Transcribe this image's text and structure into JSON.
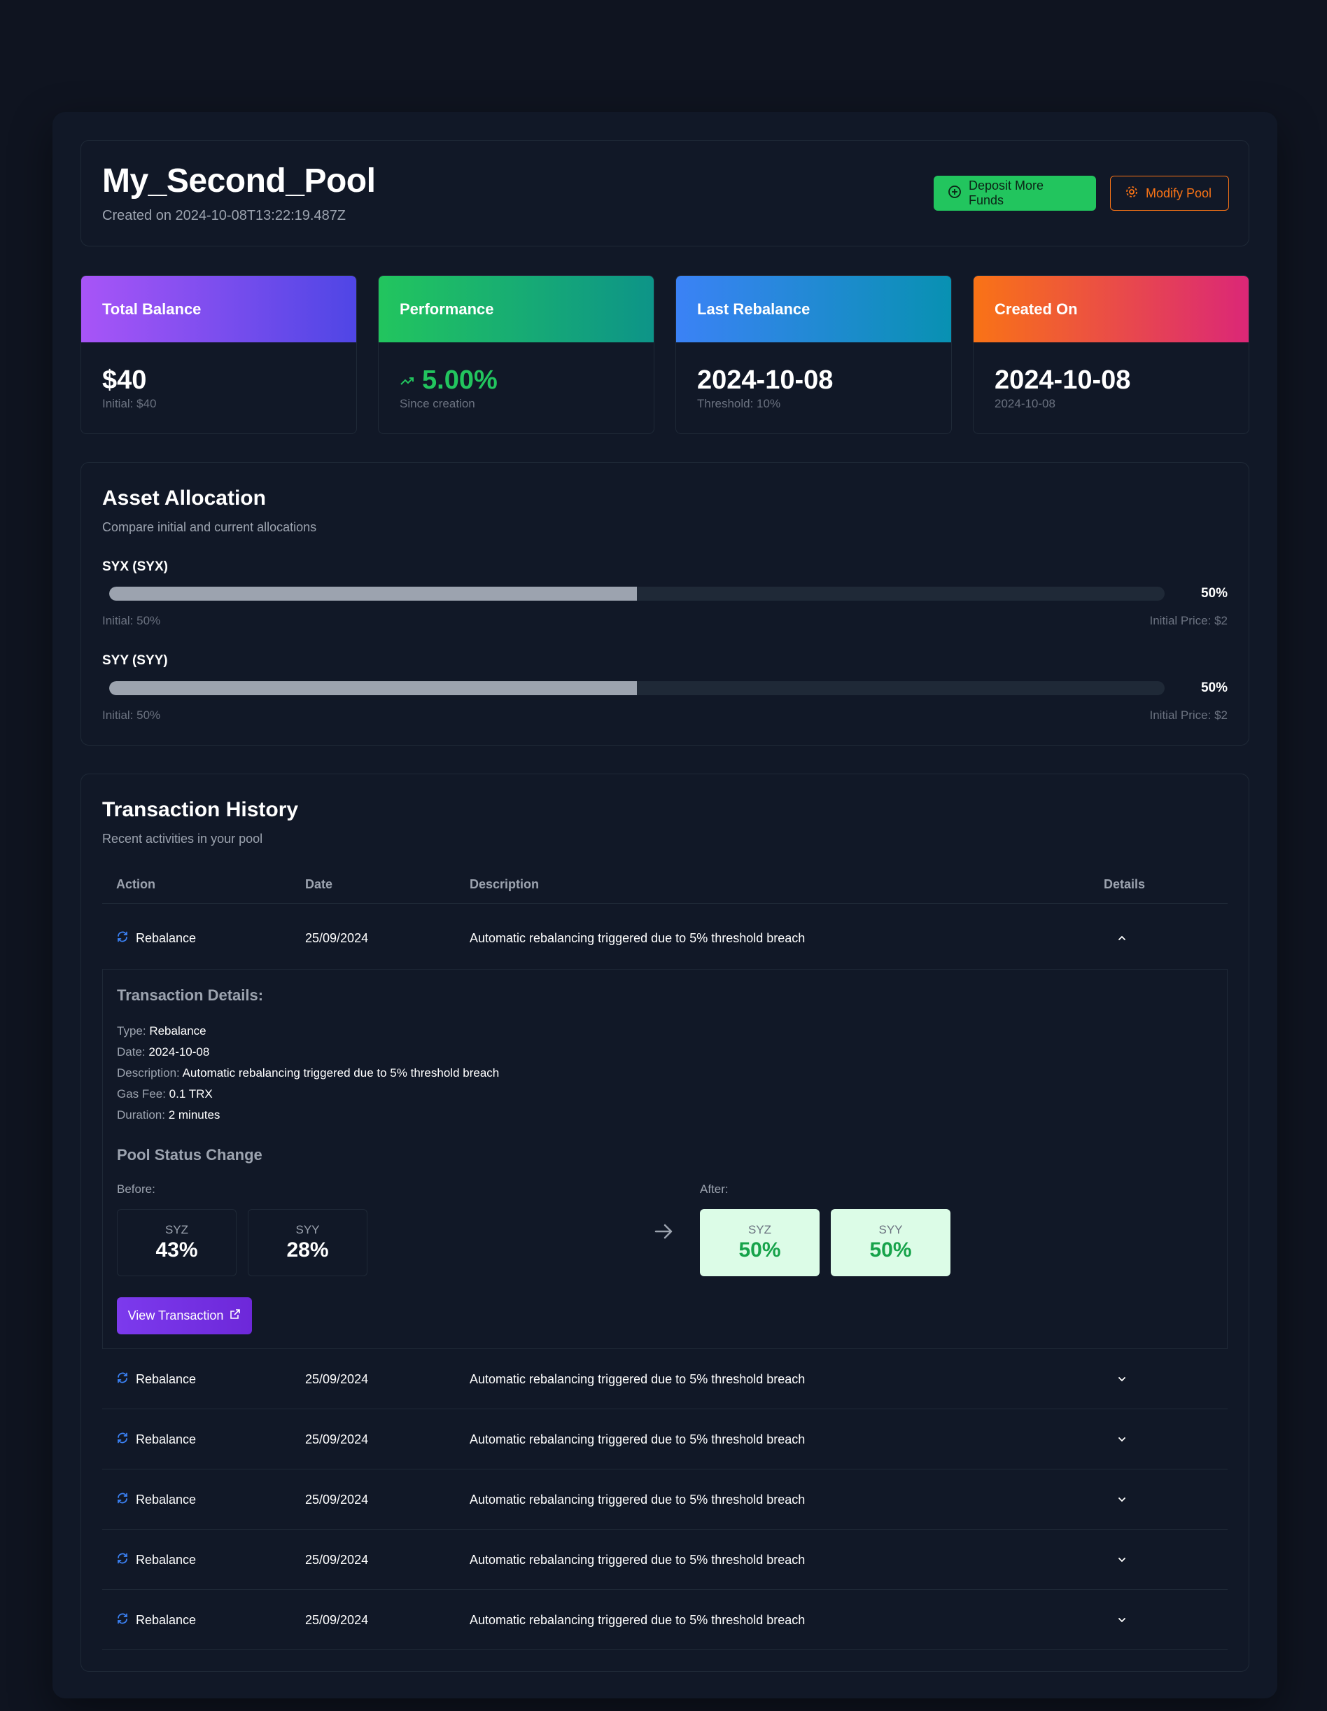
{
  "pool": {
    "name": "My_Second_Pool",
    "created_text": "Created on 2024-10-08T13:22:19.487Z",
    "deposit_label": "Deposit More Funds",
    "modify_label": "Modify Pool"
  },
  "stats": [
    {
      "title": "Total Balance",
      "value": "$40",
      "sub": "Initial: $40"
    },
    {
      "title": "Performance",
      "value": "5.00%",
      "sub": "Since creation"
    },
    {
      "title": "Last Rebalance",
      "value": "2024-10-08",
      "sub": "Threshold: 10%"
    },
    {
      "title": "Created On",
      "value": "2024-10-08",
      "sub": "2024-10-08"
    }
  ],
  "colors": {
    "positive": "#22c55e",
    "accent_orange": "#f97316",
    "purple": "#7c3aed"
  },
  "allocation": {
    "title": "Asset Allocation",
    "subtitle": "Compare initial and current allocations",
    "assets": [
      {
        "name": "SYX (SYX)",
        "current": "50%",
        "current_fraction": 0.5,
        "initial": "Initial: 50%",
        "price": "Initial Price: $2"
      },
      {
        "name": "SYY (SYY)",
        "current": "50%",
        "current_fraction": 0.5,
        "initial": "Initial: 50%",
        "price": "Initial Price: $2"
      }
    ]
  },
  "transactions": {
    "title": "Transaction History",
    "subtitle": "Recent activities in your pool",
    "columns": [
      "Action",
      "Date",
      "Description",
      "Details"
    ],
    "rows": [
      {
        "action": "Rebalance",
        "date": "25/09/2024",
        "description": "Automatic rebalancing triggered due to 5% threshold breach",
        "expanded": true
      },
      {
        "action": "Rebalance",
        "date": "25/09/2024",
        "description": "Automatic rebalancing triggered due to 5% threshold breach",
        "expanded": false
      },
      {
        "action": "Rebalance",
        "date": "25/09/2024",
        "description": "Automatic rebalancing triggered due to 5% threshold breach",
        "expanded": false
      },
      {
        "action": "Rebalance",
        "date": "25/09/2024",
        "description": "Automatic rebalancing triggered due to 5% threshold breach",
        "expanded": false
      },
      {
        "action": "Rebalance",
        "date": "25/09/2024",
        "description": "Automatic rebalancing triggered due to 5% threshold breach",
        "expanded": false
      },
      {
        "action": "Rebalance",
        "date": "25/09/2024",
        "description": "Automatic rebalancing triggered due to 5% threshold breach",
        "expanded": false
      }
    ],
    "details": {
      "title": "Transaction Details:",
      "fields": [
        {
          "key": "Type:",
          "value": "Rebalance"
        },
        {
          "key": "Date:",
          "value": "2024-10-08"
        },
        {
          "key": "Description:",
          "value": "Automatic rebalancing triggered due to 5% threshold breach"
        },
        {
          "key": "Gas Fee:",
          "value": "0.1 TRX"
        },
        {
          "key": "Duration:",
          "value": "2 minutes"
        }
      ],
      "status_title": "Pool Status Change",
      "before_label": "Before:",
      "after_label": "After:",
      "before": [
        {
          "token": "SYZ",
          "pct": "43%"
        },
        {
          "token": "SYY",
          "pct": "28%"
        }
      ],
      "after": [
        {
          "token": "SYZ",
          "pct": "50%"
        },
        {
          "token": "SYY",
          "pct": "50%"
        }
      ],
      "view_label": "View Transaction"
    }
  }
}
